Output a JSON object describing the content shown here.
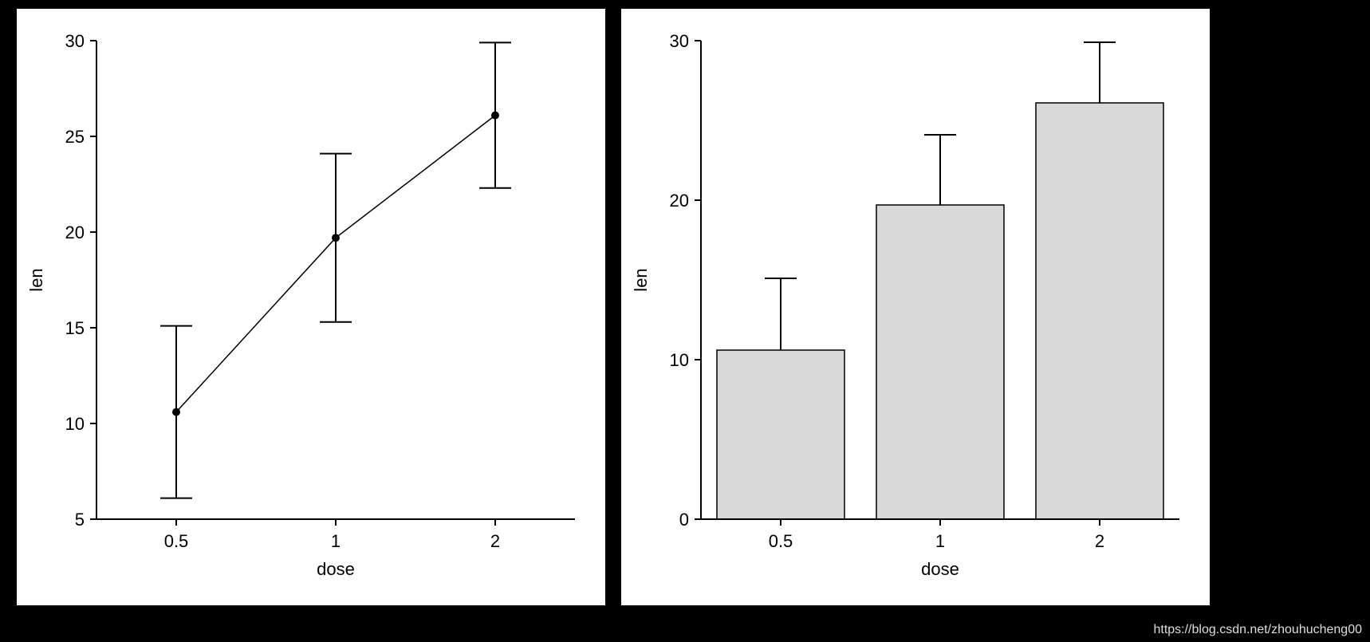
{
  "chart_data": [
    {
      "type": "line",
      "xlabel": "dose",
      "ylabel": "len",
      "categories": [
        "0.5",
        "1",
        "2"
      ],
      "y_ticks": [
        5,
        10,
        15,
        20,
        25,
        30
      ],
      "ylim": [
        5,
        30
      ],
      "series": [
        {
          "name": "len",
          "values": [
            10.6,
            19.7,
            26.1
          ],
          "error_lower": [
            6.1,
            15.3,
            22.3
          ],
          "error_upper": [
            15.1,
            24.1,
            29.9
          ]
        }
      ]
    },
    {
      "type": "bar",
      "xlabel": "dose",
      "ylabel": "len",
      "categories": [
        "0.5",
        "1",
        "2"
      ],
      "y_ticks": [
        0,
        10,
        20,
        30
      ],
      "ylim": [
        0,
        30
      ],
      "series": [
        {
          "name": "len",
          "values": [
            10.6,
            19.7,
            26.1
          ],
          "error_upper": [
            15.1,
            24.1,
            29.9
          ]
        }
      ]
    }
  ],
  "left": {
    "xlabel": "dose",
    "ylabel": "len",
    "xticks": {
      "t0": "0.5",
      "t1": "1",
      "t2": "2"
    },
    "yticks": {
      "t5": "5",
      "t10": "10",
      "t15": "15",
      "t20": "20",
      "t25": "25",
      "t30": "30"
    }
  },
  "right": {
    "xlabel": "dose",
    "ylabel": "len",
    "xticks": {
      "t0": "0.5",
      "t1": "1",
      "t2": "2"
    },
    "yticks": {
      "t0": "0",
      "t10": "10",
      "t20": "20",
      "t30": "30"
    }
  },
  "watermark": "https://blog.csdn.net/zhouhucheng00"
}
